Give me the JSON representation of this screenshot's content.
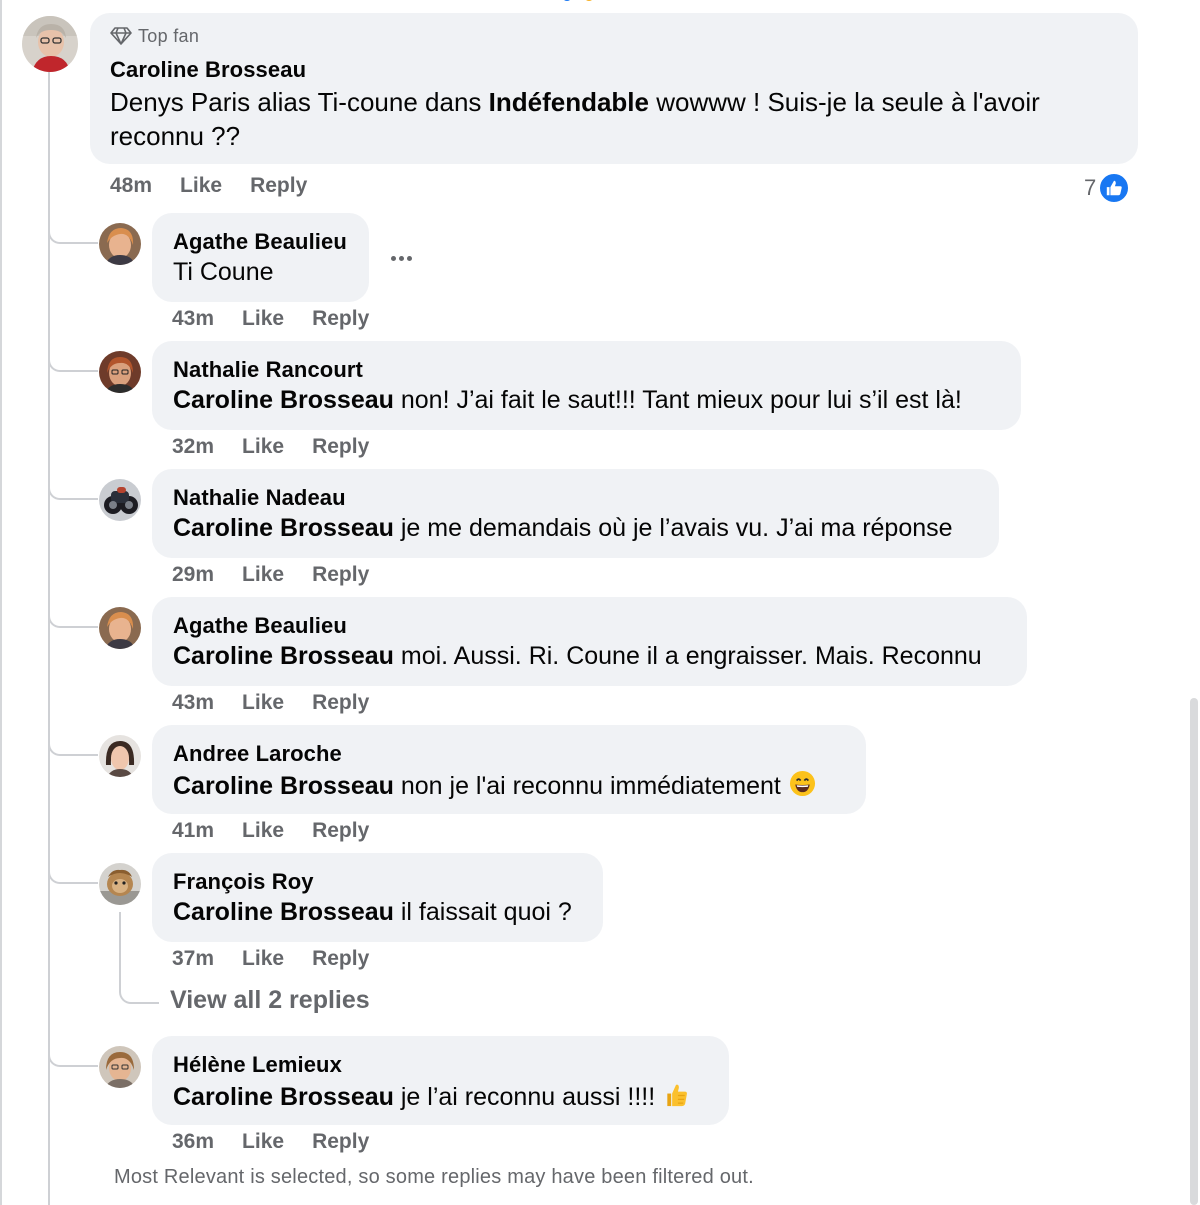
{
  "main_comment": {
    "badge": "Top fan",
    "badge_icon": "diamond-icon",
    "author": "Caroline Brosseau",
    "text_part1": "Denys Paris alias Ti-coune dans ",
    "text_bold": "Indéfendable",
    "text_part2": " wowww ! Suis-je la seule à l'avoir",
    "text_line2": "reconnu ??",
    "time": "48m",
    "like": "Like",
    "reply": "Reply",
    "reaction_count": "7",
    "reaction_icon": "thumbs-up-icon"
  },
  "replies": [
    {
      "author": "Agathe Beaulieu",
      "mention": "",
      "text": "Ti Coune",
      "time": "43m",
      "like": "Like",
      "reply": "Reply"
    },
    {
      "author": "Nathalie Rancourt",
      "mention": "Caroline Brosseau",
      "text": " non! J’ai fait le saut!!! Tant mieux pour lui s’il est là!",
      "time": "32m",
      "like": "Like",
      "reply": "Reply"
    },
    {
      "author": "Nathalie Nadeau",
      "mention": "Caroline Brosseau",
      "text": " je me demandais où je l’avais vu. J’ai ma réponse",
      "time": "29m",
      "like": "Like",
      "reply": "Reply"
    },
    {
      "author": "Agathe Beaulieu",
      "mention": "Caroline Brosseau",
      "text": " moi. Aussi. Ri. Coune il a engraisser. Mais. Reconnu",
      "time": "43m",
      "like": "Like",
      "reply": "Reply"
    },
    {
      "author": "Andree Laroche",
      "mention": "Caroline Brosseau",
      "text": " non je l'ai reconnu immédiatement",
      "emoji": "grinning-face-emoji",
      "time": "41m",
      "like": "Like",
      "reply": "Reply"
    },
    {
      "author": "François Roy",
      "mention": "Caroline Brosseau",
      "text": " il faissait quoi ?",
      "time": "37m",
      "like": "Like",
      "reply": "Reply"
    },
    {
      "author": "Hélène Lemieux",
      "mention": "Caroline Brosseau",
      "text": " je l’ai reconnu aussi !!!!",
      "emoji": "thumbs-up-emoji",
      "time": "36m",
      "like": "Like",
      "reply": "Reply"
    }
  ],
  "view_replies": "View all 2 replies",
  "footer_note": "Most Relevant is selected, so some replies may have been filtered out.",
  "colors": {
    "bubble": "#f0f2f5",
    "meta_text": "#65676b",
    "reaction_blue": "#1877f2",
    "thread_line": "#ced0d4"
  }
}
